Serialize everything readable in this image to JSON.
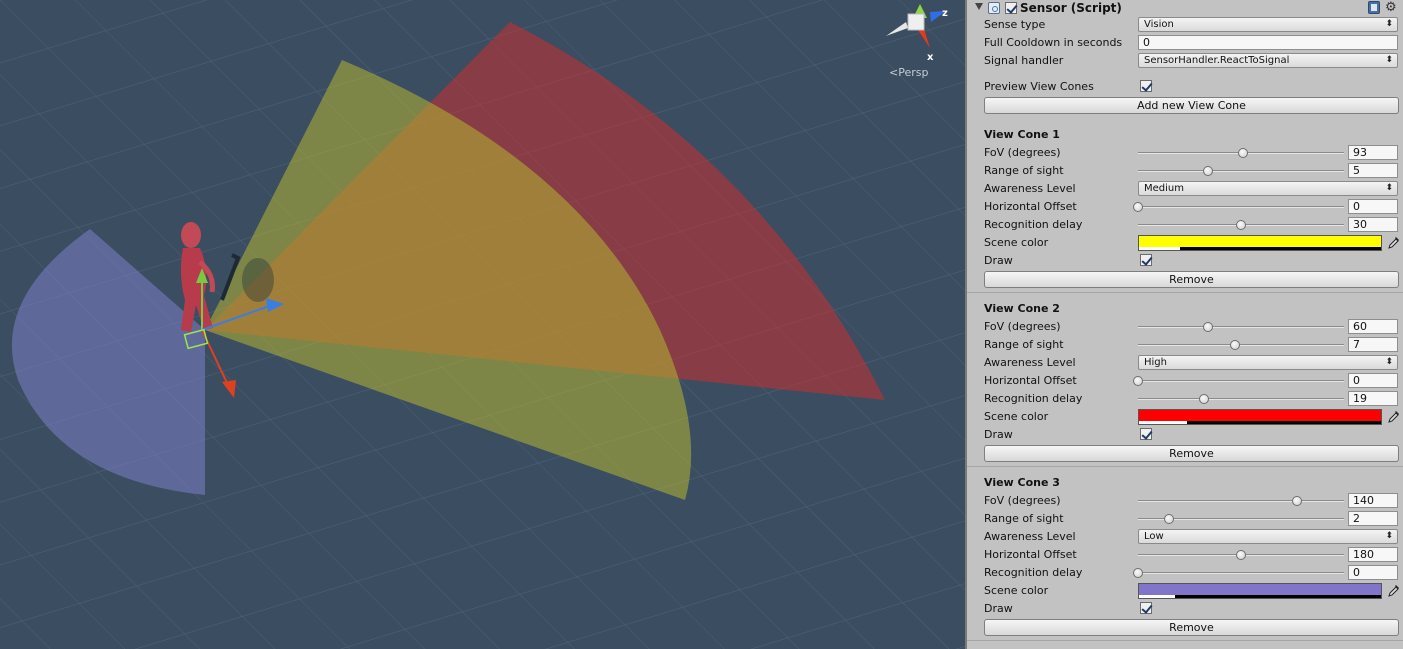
{
  "scene": {
    "persp_label": "<Persp",
    "axis_labels": {
      "z": "z",
      "x": "x"
    },
    "cones": [
      {
        "name": "view-cone-3",
        "color": "#7b7fc9"
      },
      {
        "name": "view-cone-1",
        "color": "#b5b732"
      },
      {
        "name": "view-cone-2",
        "color": "#c83030"
      }
    ]
  },
  "inspector": {
    "component_title": "Sensor (Script)",
    "component_enabled": true,
    "sense_type_label": "Sense type",
    "sense_type_value": "Vision",
    "cooldown_label": "Full Cooldown in seconds",
    "cooldown_value": "0",
    "signal_label": "Signal handler",
    "signal_value": "SensorHandler.ReactToSignal",
    "preview_label": "Preview View Cones",
    "preview_checked": true,
    "add_button": "Add new View Cone",
    "field_labels": {
      "fov": "FoV (degrees)",
      "range": "Range of sight",
      "awareness": "Awareness Level",
      "offset": "Horizontal Offset",
      "delay": "Recognition delay",
      "color": "Scene color",
      "draw": "Draw"
    },
    "remove_label": "Remove",
    "cones": [
      {
        "title": "View Cone 1",
        "fov": "93",
        "fov_frac": 0.51,
        "range": "5",
        "range_frac": 0.34,
        "awareness": "Medium",
        "offset": "0",
        "offset_frac": 0.0,
        "delay": "30",
        "delay_frac": 0.5,
        "color": "#ffff00",
        "alpha_frac": 0.17,
        "draw": true
      },
      {
        "title": "View Cone 2",
        "fov": "60",
        "fov_frac": 0.34,
        "range": "7",
        "range_frac": 0.47,
        "awareness": "High",
        "offset": "0",
        "offset_frac": 0.0,
        "delay": "19",
        "delay_frac": 0.32,
        "color": "#ff0000",
        "alpha_frac": 0.2,
        "draw": true
      },
      {
        "title": "View Cone 3",
        "fov": "140",
        "fov_frac": 0.77,
        "range": "2",
        "range_frac": 0.15,
        "awareness": "Low",
        "offset": "180",
        "offset_frac": 0.5,
        "delay": "0",
        "delay_frac": 0.0,
        "color": "#8075c8",
        "alpha_frac": 0.15,
        "draw": true
      }
    ]
  }
}
